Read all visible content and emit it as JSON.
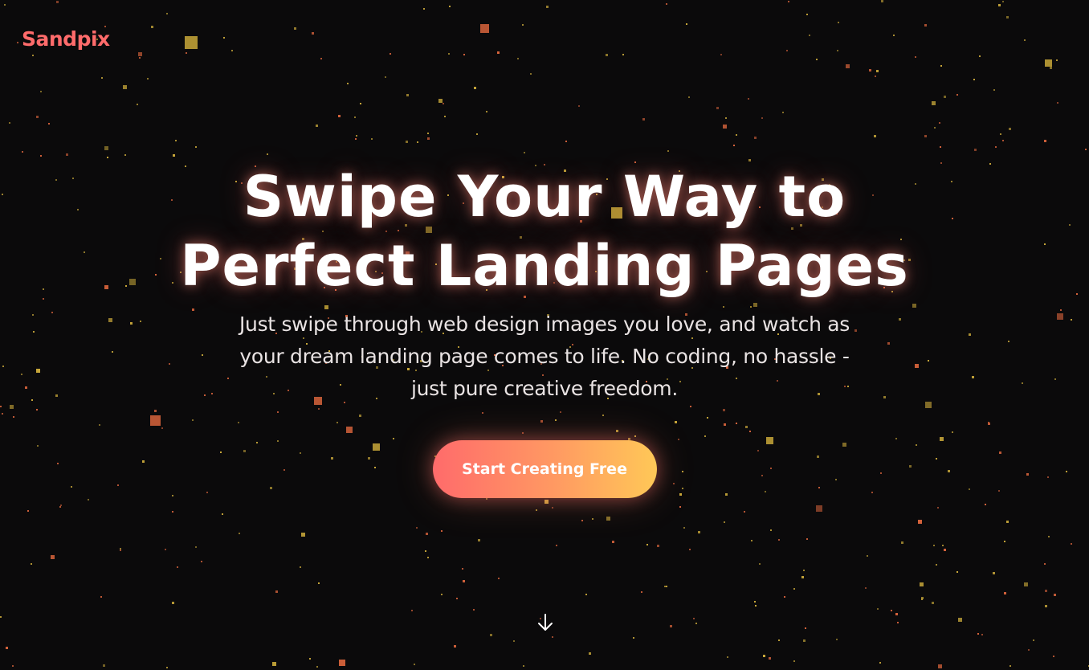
{
  "brand": {
    "name": "Sandpix",
    "color": "#ff6b6b"
  },
  "hero": {
    "headline_line1": "Swipe Your Way to",
    "headline_line2": "Perfect Landing Pages",
    "subtitle_line1": "Just swipe through web design images you love, and watch as",
    "subtitle_line2": "your dream landing page comes to life. No coding, no hassle -",
    "subtitle_line3": "just pure creative freedom.",
    "cta_label": "Start Creating Free"
  },
  "scroll_indicator": {
    "icon": "arrow-down-icon"
  },
  "colors": {
    "background": "#0b0a0b",
    "accent_start": "#ff6b6b",
    "accent_end": "#ffc857",
    "particle_gold": "#c9a83a",
    "particle_orange": "#d8643c"
  }
}
